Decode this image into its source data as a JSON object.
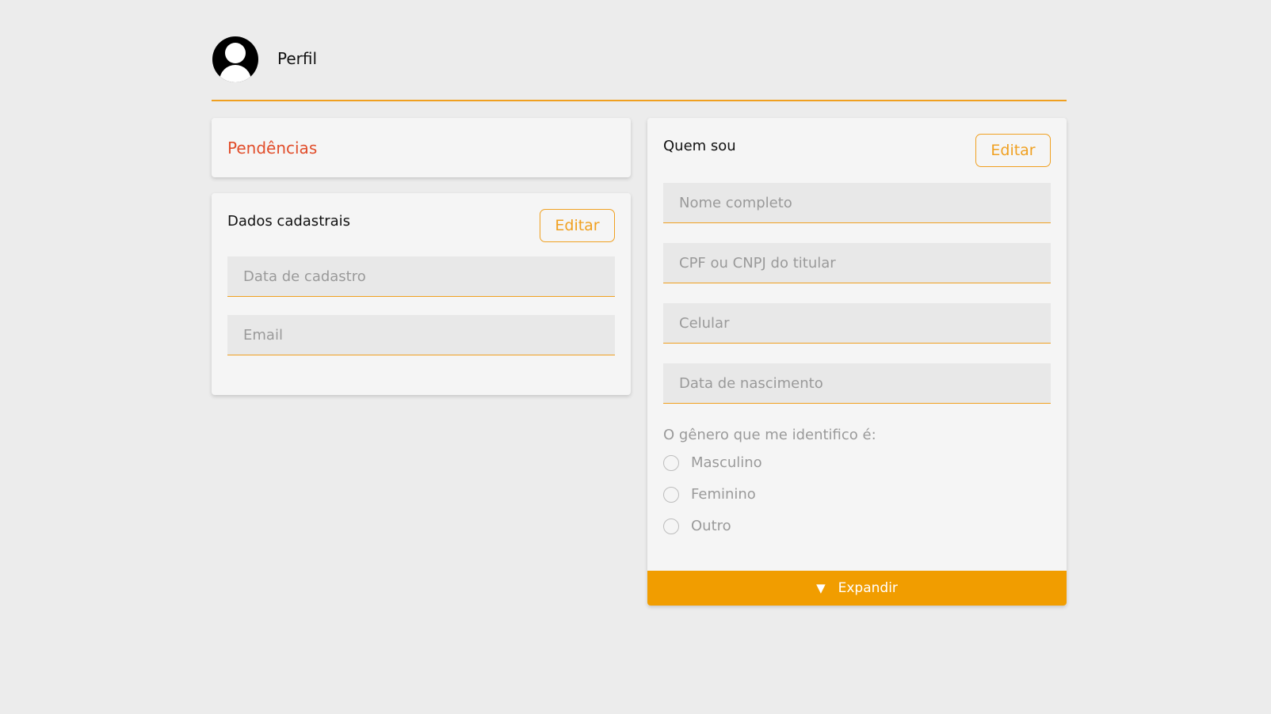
{
  "header": {
    "title": "Perfil"
  },
  "pendencias": {
    "title": "Pendências"
  },
  "dados_cadastrais": {
    "title": "Dados cadastrais",
    "edit_label": "Editar",
    "fields": {
      "data_cadastro": {
        "placeholder": "Data de cadastro",
        "value": ""
      },
      "email": {
        "placeholder": "Email",
        "value": ""
      }
    }
  },
  "quem_sou": {
    "title": "Quem sou",
    "edit_label": "Editar",
    "fields": {
      "nome": {
        "placeholder": "Nome completo",
        "value": ""
      },
      "cpf": {
        "placeholder": "CPF ou CNPJ do titular",
        "value": ""
      },
      "celular": {
        "placeholder": "Celular",
        "value": ""
      },
      "nascimento": {
        "placeholder": "Data de nascimento",
        "value": ""
      }
    },
    "gender": {
      "label": "O gênero que me identifico é:",
      "options": [
        "Masculino",
        "Feminino",
        "Outro"
      ],
      "selected": null
    },
    "expand_label": "Expandir",
    "expand_icon": "triangle-down-icon"
  },
  "colors": {
    "accent": "#f0a020",
    "expand_bar": "#f19d00",
    "pending_title": "#e14d2a",
    "background": "#ececec",
    "card": "#f5f5f5"
  }
}
